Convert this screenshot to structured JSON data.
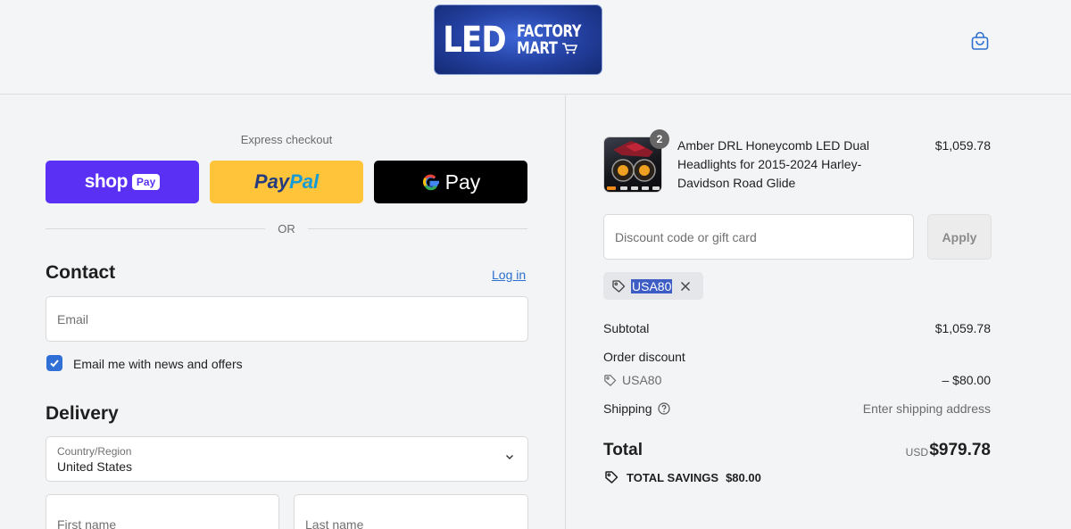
{
  "header": {
    "logo": {
      "big": "LED",
      "line1": "FACTORY",
      "line2": "MART"
    },
    "cart_icon": "shopping-bag-icon"
  },
  "express": {
    "label": "Express checkout",
    "shop_pay": {
      "word": "shop",
      "badge": "Pay"
    },
    "paypal": {
      "pay": "Pay",
      "pal": "Pal"
    },
    "gpay": {
      "g": "G",
      "word": "Pay"
    },
    "or_text": "OR"
  },
  "contact": {
    "title": "Contact",
    "login": "Log in",
    "email_placeholder": "Email",
    "newsletter_label": "Email me with news and offers",
    "newsletter_checked": true
  },
  "delivery": {
    "title": "Delivery",
    "country_label": "Country/Region",
    "country_value": "United States",
    "first_name_placeholder": "First name",
    "last_name_placeholder": "Last name"
  },
  "order": {
    "product": {
      "name": "Amber DRL Honeycomb LED Dual Headlights for 2015-2024 Harley-Davidson Road Glide",
      "price": "$1,059.78",
      "quantity": "2"
    },
    "discount_placeholder": "Discount code or gift card",
    "apply_label": "Apply",
    "applied_code": "USA80",
    "subtotal_label": "Subtotal",
    "subtotal_value": "$1,059.78",
    "order_discount_label": "Order discount",
    "discount_code": "USA80",
    "discount_value": "– $80.00",
    "shipping_label": "Shipping",
    "shipping_value": "Enter shipping address",
    "total_label": "Total",
    "total_currency": "USD",
    "total_value": "$979.78",
    "savings_label": "TOTAL SAVINGS",
    "savings_value": "$80.00"
  },
  "colors": {
    "shop_pay": "#5a31f4",
    "paypal": "#ffc439",
    "gpay": "#000000",
    "link": "#2b6fcf",
    "checkbox": "#2f6fd6"
  }
}
